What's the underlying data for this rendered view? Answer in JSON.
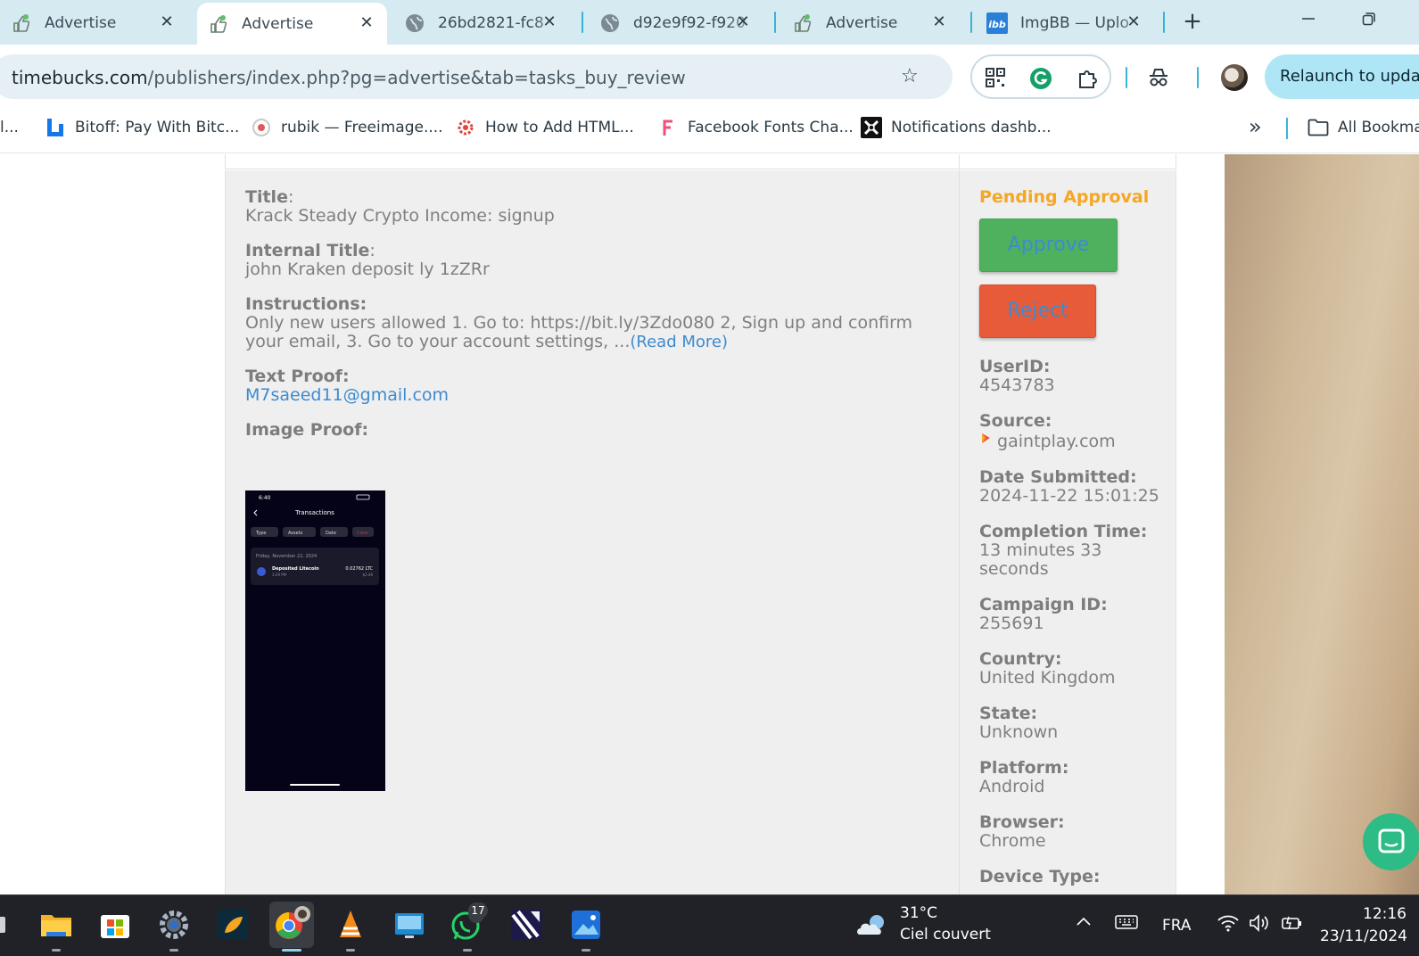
{
  "tabs": [
    {
      "title": "Advertise",
      "active": false
    },
    {
      "title": "Advertise",
      "active": true
    },
    {
      "title": "26bd2821-fc8",
      "active": false
    },
    {
      "title": "d92e9f92-f920",
      "active": false
    },
    {
      "title": "Advertise",
      "active": false
    },
    {
      "title": "ImgBB — Uplo",
      "active": false
    }
  ],
  "address": {
    "host": "timebucks.com",
    "path": "/publishers/index.php?pg=advertise&tab=tasks_buy_review"
  },
  "toolbar": {
    "relaunch_label": "Relaunch to update"
  },
  "bookmarks": {
    "items": [
      {
        "label": "l..."
      },
      {
        "label": "Bitoff: Pay With Bitc..."
      },
      {
        "label": "rubik — Freeimage...."
      },
      {
        "label": "How to Add HTML..."
      },
      {
        "label": "Facebook Fonts Cha..."
      },
      {
        "label": "Notifications dashb..."
      }
    ],
    "all_bookmarks": "All Bookmarks"
  },
  "task": {
    "title_label": "Title",
    "title_value": "Krack Steady Crypto Income: signup",
    "internal_title_label": "Internal Title",
    "internal_title_value": "john Kraken deposit ly 1zZRr",
    "instructions_label": "Instructions:",
    "instructions_value": "Only new users allowed 1. Go to: https://bit.ly/3Zdo080 2, Sign up and confirm your email, 3. Go to your account settings, ...",
    "read_more": "(Read More)",
    "text_proof_label": "Text Proof:",
    "text_proof_value": "M7saeed11@gmail.com",
    "image_proof_label": "Image Proof:",
    "proof_screenshot": {
      "time": "6:40",
      "heading": "Transactions",
      "filters": [
        "Type",
        "Assets",
        "Date",
        "Clear"
      ],
      "date": "Friday, November 22, 2024",
      "tx_title": "Deposited Litecoin",
      "tx_time": "3:29 PM",
      "tx_amount": "0.02762 LTC",
      "tx_fiat": "$2.46"
    }
  },
  "review": {
    "status": "Pending Approval",
    "approve_label": "Approve",
    "reject_label": "Reject",
    "fields": [
      {
        "label": "UserID:",
        "value": "4543783"
      },
      {
        "label": "Source:",
        "value": "gaintplay.com"
      },
      {
        "label": "Date Submitted:",
        "value": "2024-11-22 15:01:25"
      },
      {
        "label": "Completion Time:",
        "value": "13 minutes 33 seconds"
      },
      {
        "label": "Campaign ID:",
        "value": "255691"
      },
      {
        "label": "Country:",
        "value": "United Kingdom"
      },
      {
        "label": "State:",
        "value": "Unknown"
      },
      {
        "label": "Platform:",
        "value": "Android"
      },
      {
        "label": "Browser:",
        "value": "Chrome"
      },
      {
        "label": "Device Type:",
        "value": ""
      }
    ]
  },
  "taskbar": {
    "weather_temp": "31°C",
    "weather_desc": "Ciel couvert",
    "language": "FRA",
    "time": "12:16",
    "date": "23/11/2024",
    "whatsapp_badge": "17"
  },
  "colors": {
    "pending": "#f5a623",
    "approve": "#4fb15e",
    "reject": "#e85b38",
    "link": "#3d8bd0",
    "tabstrip": "#d5eaf1"
  }
}
